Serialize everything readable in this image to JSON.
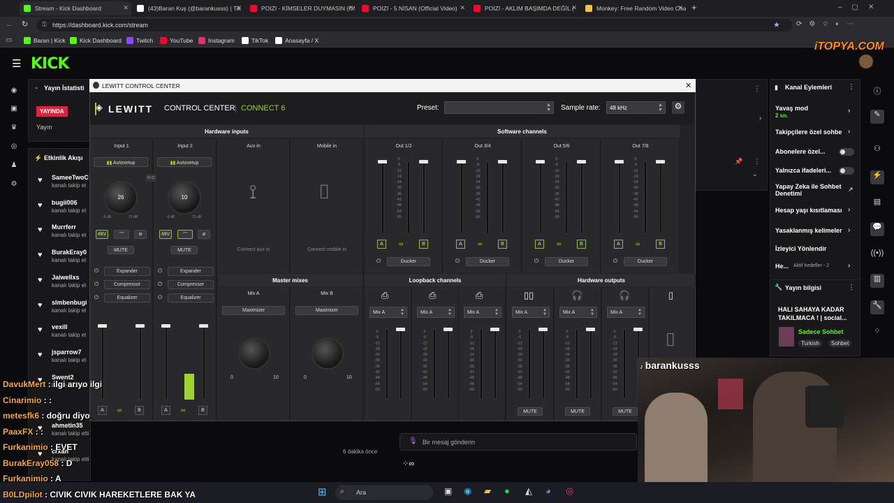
{
  "browser": {
    "tabs": [
      {
        "label": "Stream - Kick Dashboard",
        "color": "#53fc18"
      },
      {
        "label": "(43)Baran Kuş (@barankusss) | Tik",
        "color": "#ffffff"
      },
      {
        "label": "POIZI - KİMSELER DUYMASIN (Of",
        "color": "#ff0033"
      },
      {
        "label": "POIZI - 5 NİSAN (Official Video)",
        "color": "#ff0033"
      },
      {
        "label": "POIZI - AKLIM BAŞIMDA DEĞİL (",
        "color": "#ff0033"
      },
      {
        "label": "Monkey: Free Random Video Cha",
        "color": "#f2c14e"
      }
    ],
    "url": "https://dashboard.kick.com/stream",
    "bookmarks": [
      {
        "label": "Baran | Kick",
        "color": "#53fc18"
      },
      {
        "label": "Kick Dashboard",
        "color": "#53fc18"
      },
      {
        "label": "Twitch",
        "color": "#9146ff"
      },
      {
        "label": "YouTube",
        "color": "#ff0033"
      },
      {
        "label": "Instagram",
        "color": "#e1306c"
      },
      {
        "label": "TikTok",
        "color": "#ffffff"
      },
      {
        "label": "Anasayfa / X",
        "color": "#ffffff"
      }
    ]
  },
  "kick": {
    "logo": "KICK",
    "stats_title": "Yayın İstatisti",
    "live_badge": "YAYINDA",
    "stream_label": "Yayın",
    "activity_title": "Etkinlik Akışı",
    "activity": [
      {
        "name": "SameeTwoC",
        "sub": "kanalı takip et"
      },
      {
        "name": "bugii006",
        "sub": "kanalı takip et"
      },
      {
        "name": "Murrferr",
        "sub": "kanalı takip et"
      },
      {
        "name": "BurakEray0",
        "sub": "kanalı takip et"
      },
      {
        "name": "Jaiwellxs",
        "sub": "kanalı takip et"
      },
      {
        "name": "slmbenbugi",
        "sub": "kanalı takip et"
      },
      {
        "name": "vexill",
        "sub": "kanalı takip et"
      },
      {
        "name": "jsparrow7",
        "sub": "kanalı takip et"
      },
      {
        "name": "Swent2",
        "sub": "kanalı takip et"
      },
      {
        "name": "ahmetin35",
        "sub": "kanalı takip etti"
      },
      {
        "name": "crxan",
        "sub": "kanalı takip etti"
      }
    ],
    "time_ago": "6 dakika önce",
    "chat_placeholder": "Bir mesaj gönderin",
    "channel_actions_title": "Kanal Eylemleri",
    "slow_mode": "Yavaş mod",
    "slow_mode_value": "2 sn.",
    "follower_only": "Takipçilere özel sohbe",
    "subscriber_only": "Abonelere özel...",
    "emote_only": "Yalnızca ifadeleri...",
    "ai_moderation": "Yapay Zeka ile Sohbet Denetimi",
    "account_age": "Hesap yaşı kısıtlaması",
    "banned_words": "Yasaklanmış kelimeler",
    "viewer_redirect": "İzleyici Yönlendir",
    "he_label": "He...",
    "active_goals": "Aktif hedefler - 2",
    "stream_info_title": "Yayın bilgisi",
    "stream_info_text": "HALI SAHAYA KADAR TAKILMACA ! | social...",
    "category": "Sadece Sohbet",
    "tags": [
      "Turkish",
      "Sohbet"
    ]
  },
  "lewitt": {
    "window_title": "LEWITT CONTROL CENTER",
    "brand": "LEWITT",
    "product": "CONTROL CENTER",
    "device": "CONNECT 6",
    "preset_label": "Preset:",
    "sample_rate_label": "Sample rate:",
    "sample_rate": "48 kHz",
    "hardware_inputs": "Hardware inputs",
    "software_channels": "Software channels",
    "master_mixes": "Master mixes",
    "loopback_channels": "Loopback channels",
    "hardware_outputs": "Hardware outputs",
    "input1": "Input 1",
    "input2": "Input 2",
    "aux_in": "Aux in",
    "mobile_in": "Mobile in",
    "connect_aux": "Connect aux in",
    "connect_mobile": "Connect mobile in",
    "autosetup": "Autosetup",
    "input1_gain": "26",
    "input2_gain": "10",
    "gain_min": "-6 dB",
    "gain_max": "72 dB",
    "phantom": "48V",
    "phase": "ø",
    "mute": "MUTE",
    "expander": "Expander",
    "compressor": "Compressor",
    "equalizer": "Equalizer",
    "outs": [
      "Out 1/2",
      "Out 3/4",
      "Out 5/6",
      "Out 7/8"
    ],
    "ducker": "Ducker",
    "mix_a": "Mix A",
    "mix_b": "Mix B",
    "maximizer": "Maximizer",
    "knob_min": "0",
    "knob_max": "10",
    "scale": [
      "0",
      "-6",
      "-12",
      "-18",
      "-24",
      "-30",
      "-36",
      "-42",
      "-48",
      "-54",
      "-60"
    ],
    "a_label": "A",
    "b_label": "B",
    "input2_meter_level": 0.35
  },
  "overlay": {
    "chat": [
      {
        "user": "DavukMert",
        "msg": "ilgi arıyo ilgi"
      },
      {
        "user": "Cinarimio",
        "msg": ":"
      },
      {
        "user": "metesfk6",
        "msg": "doğru diyo"
      },
      {
        "user": "PaaxFX",
        "msg": ":"
      },
      {
        "user": "Furkanimio",
        "msg": "EVET"
      },
      {
        "user": "BurakEray058",
        "msg": "D"
      },
      {
        "user": "Furkanimio",
        "msg": "A"
      },
      {
        "user": "B0LDpilot",
        "msg": "CIVIK CIVIK HAREKETLERE BAK YA"
      }
    ],
    "webcam_name": "barankusss",
    "watermark": "iTOPYA.COM",
    "search_placeholder": "Ara"
  }
}
